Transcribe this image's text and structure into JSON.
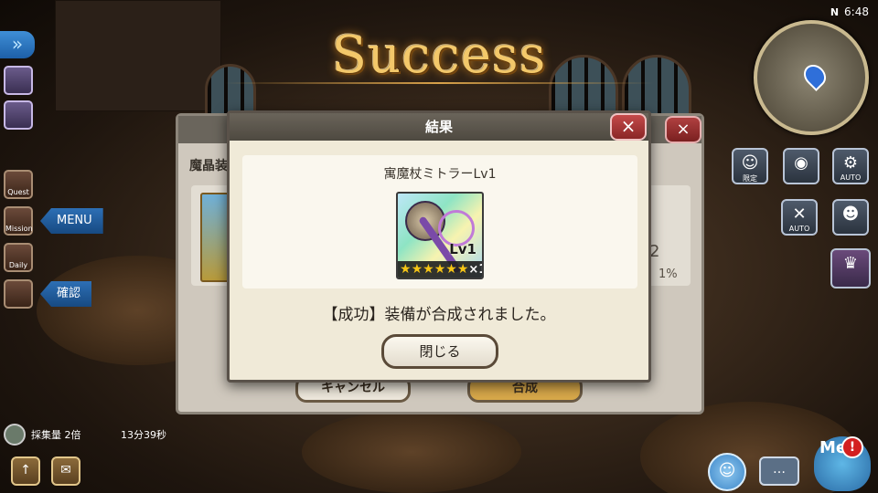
{
  "status_bar": {
    "network": "N",
    "time": "6:48"
  },
  "banner": {
    "text": "Success"
  },
  "left_rail": {
    "buttons": [
      {
        "label": "",
        "icon": "shield-icon"
      },
      {
        "label": "",
        "icon": "map-icon"
      },
      {
        "label": "Quest",
        "icon": "scroll-icon"
      },
      {
        "label": "Mission",
        "icon": "book-icon"
      },
      {
        "label": "Daily",
        "icon": "calendar-icon"
      },
      {
        "label": "",
        "icon": "handshake-icon"
      }
    ],
    "menu_label": "MENU",
    "confirm_label": "確認"
  },
  "right_rail": {
    "limited_label": "限定",
    "auto_label": "AUTO",
    "auto_skill_label": "AUTO"
  },
  "bottom_left": {
    "gather_label": "採集量 2倍",
    "timer": "13分39秒"
  },
  "bottom_right": {
    "mascot_label": "Me",
    "alert": "!"
  },
  "bg_panel": {
    "section_title": "魔晶装",
    "number": "2",
    "percent": "1%",
    "cancel_label": "キャンセル",
    "ok_label": "合成"
  },
  "dialog": {
    "title": "結果",
    "close_glyph": "×",
    "item": {
      "name": "寓魔杖ミトラーLv1",
      "level_badge": "Lv1",
      "stars": 6,
      "quantity": "×1"
    },
    "message": "【成功】装備が合成されました。",
    "button_label": "閉じる"
  },
  "colors": {
    "banner_gold": "#f3c86a",
    "close_red": "#c44a4a",
    "star_yellow": "#f6c516",
    "menu_blue": "#2d6fb5"
  }
}
